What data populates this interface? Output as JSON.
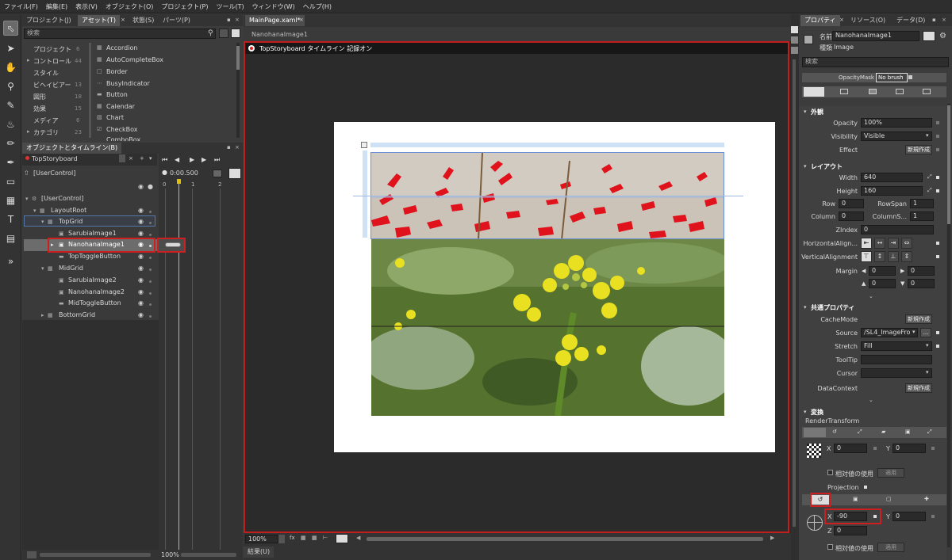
{
  "menu": [
    "ファイル(F)",
    "編集(E)",
    "表示(V)",
    "オブジェクト(O)",
    "プロジェクト(P)",
    "ツール(T)",
    "ウィンドウ(W)",
    "ヘルプ(H)"
  ],
  "assets": {
    "tabs": [
      "プロジェクト(J)",
      "アセット(T)",
      "状態(S)",
      "パーツ(P)"
    ],
    "search_placeholder": "検索",
    "categories": [
      {
        "label": "プロジェクト",
        "count": "6"
      },
      {
        "label": "コントロール",
        "count": "44"
      },
      {
        "label": "スタイル",
        "count": ""
      },
      {
        "label": "ビヘイビアー",
        "count": "13"
      },
      {
        "label": "図形",
        "count": "18"
      },
      {
        "label": "効果",
        "count": "15"
      },
      {
        "label": "メディア",
        "count": "6"
      },
      {
        "label": "カテゴリ",
        "count": "23"
      }
    ],
    "items": [
      "Accordion",
      "AutoCompleteBox",
      "Border",
      "BusyIndicator",
      "Button",
      "Calendar",
      "Chart",
      "CheckBox",
      "ComboBox"
    ]
  },
  "objects": {
    "title": "オブジェクトとタイムライン(B)",
    "storyboard": "TopStoryboard",
    "time": "0:00.500",
    "ruler": [
      "0",
      "1",
      "2"
    ],
    "root": "[UserControl]",
    "tree": [
      {
        "label": "[UserControl]"
      },
      {
        "label": "LayoutRoot"
      },
      {
        "label": "TopGrid"
      },
      {
        "label": "SarubiaImage1"
      },
      {
        "label": "NanohanaImage1"
      },
      {
        "label": "TopToggleButton"
      },
      {
        "label": "MidGrid"
      },
      {
        "label": "SarubiaImage2"
      },
      {
        "label": "NanohanaImage2"
      },
      {
        "label": "MidToggleButton"
      },
      {
        "label": "BottomGrid"
      }
    ],
    "zoom": "100%"
  },
  "document": {
    "tab": "MainPage.xaml*",
    "breadcrumb": "NanohanaImage1",
    "recording": "TopStoryboard タイムライン 記録オン",
    "zoom": "100%",
    "results_label": "結果(U)"
  },
  "properties": {
    "tabs": [
      "プロパティ",
      "リソース(O)",
      "データ(D)"
    ],
    "name_label": "名前",
    "name_value": "NanohanaImage1",
    "type_label": "種類",
    "type_value": "Image",
    "search_placeholder": "検索",
    "opacitymask_label": "OpacityMask",
    "opacitymask_value": "No brush",
    "appearance": {
      "header": "外観",
      "opacity_label": "Opacity",
      "opacity_value": "100%",
      "visibility_label": "Visibility",
      "visibility_value": "Visible",
      "effect_label": "Effect",
      "new_button": "新規作成"
    },
    "layout": {
      "header": "レイアウト",
      "width_label": "Width",
      "width_value": "640",
      "height_label": "Height",
      "height_value": "160",
      "row_label": "Row",
      "row_value": "0",
      "rowspan_label": "RowSpan",
      "rowspan_value": "1",
      "column_label": "Column",
      "column_value": "0",
      "columnspan_label": "ColumnS...",
      "columnspan_value": "1",
      "zindex_label": "ZIndex",
      "zindex_value": "0",
      "halign_label": "HorizontalAlign...",
      "valign_label": "VerticalAlignment",
      "margin_label": "Margin",
      "margin_values": [
        "0",
        "0",
        "0",
        "0"
      ]
    },
    "common": {
      "header": "共通プロパティ",
      "cachemode_label": "CacheMode",
      "source_label": "Source",
      "source_value": "/SL4_ImageFro",
      "stretch_label": "Stretch",
      "stretch_value": "Fill",
      "tooltip_label": "ToolTip",
      "cursor_label": "Cursor",
      "datacontext_label": "DataContext",
      "new_button": "新規作成",
      "ellipsis": "..."
    },
    "transform": {
      "header": "変換",
      "render_label": "RenderTransform",
      "x_label": "X",
      "x_value": "0",
      "y_label": "Y",
      "y_value": "0",
      "relative_label": "相対値の使用",
      "apply_button": "適用",
      "projection_label": "Projection",
      "proj_x_value": "-90",
      "proj_y_value": "0",
      "z_label": "Z",
      "z_value": "0"
    }
  }
}
